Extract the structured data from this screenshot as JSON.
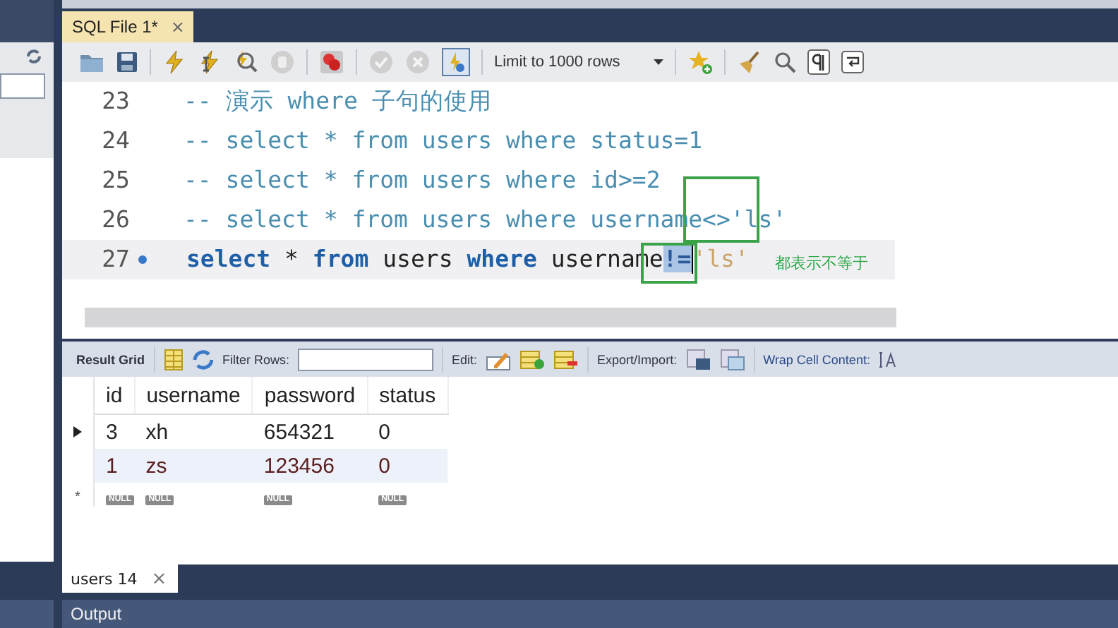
{
  "editor_tab": {
    "title": "SQL File 1*",
    "close": "×"
  },
  "toolbar": {
    "limit": "Limit to 1000 rows"
  },
  "code_lines": [
    {
      "number": "23",
      "current": false,
      "tokens": [
        {
          "kind": "comment",
          "text": "-- 演示 where 子句的使用"
        }
      ]
    },
    {
      "number": "24",
      "current": false,
      "tokens": [
        {
          "kind": "comment",
          "text": "-- select * from users where status=1"
        }
      ]
    },
    {
      "number": "25",
      "current": false,
      "tokens": [
        {
          "kind": "comment",
          "text": "-- select * from users where id>=2"
        }
      ]
    },
    {
      "number": "26",
      "current": false,
      "tokens": [
        {
          "kind": "comment",
          "text": "-- select * from users where username<>'ls'"
        }
      ]
    },
    {
      "number": "27",
      "current": true,
      "tokens": [
        {
          "kind": "keyword",
          "text": "select"
        },
        {
          "kind": "plain",
          "text": " * "
        },
        {
          "kind": "keyword",
          "text": "from"
        },
        {
          "kind": "plain",
          "text": " users "
        },
        {
          "kind": "keyword",
          "text": "where"
        },
        {
          "kind": "plain",
          "text": " username"
        },
        {
          "kind": "selection",
          "text": "!="
        },
        {
          "kind": "string",
          "text": "'ls'"
        }
      ]
    }
  ],
  "annotation": {
    "note": "都表示不等于"
  },
  "result_toolbar": {
    "result_grid": "Result Grid",
    "filter_label": "Filter Rows:",
    "edit_label": "Edit:",
    "export_label": "Export/Import:",
    "wrap_label": "Wrap Cell Content:"
  },
  "grid": {
    "columns": [
      "id",
      "username",
      "password",
      "status"
    ],
    "rows": [
      {
        "current": true,
        "cells": [
          "3",
          "xh",
          "654321",
          "0"
        ]
      },
      {
        "current": false,
        "cells": [
          "1",
          "zs",
          "123456",
          "0"
        ]
      }
    ],
    "new_row": {
      "marker": "*",
      "cells": [
        "NULL",
        "NULL",
        "NULL",
        "NULL"
      ]
    }
  },
  "result_tab": {
    "title": "users 14",
    "close": "×"
  },
  "output": {
    "title": "Output"
  }
}
